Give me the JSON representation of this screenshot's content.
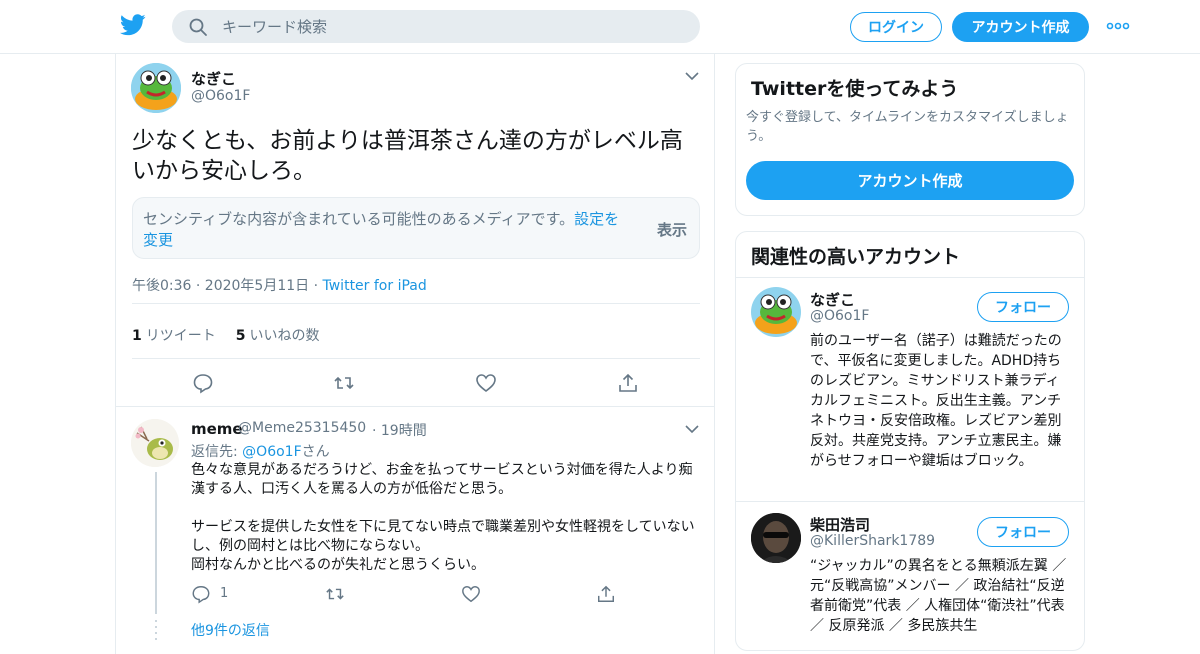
{
  "header": {
    "search_placeholder": "キーワード検索",
    "login_label": "ログイン",
    "signup_label": "アカウント作成"
  },
  "tweet": {
    "name": "なぎこ",
    "handle": "@O6o1F",
    "text": "少なくとも、お前よりは普洱茶さん達の方がレベル高いから安心しろ。",
    "sensitive_msg": "センシティブな内容が含まれている可能性のあるメディアです。",
    "sensitive_link": "設定を変更",
    "show_label": "表示",
    "time": "午後0:36 · 2020年5月11日",
    "via": "Twitter for iPad",
    "retweet_count": "1",
    "retweet_label": "リツイート",
    "like_count": "5",
    "like_label": "いいねの数"
  },
  "reply": {
    "name": "meme",
    "handle": "@Meme25315450",
    "time": "· 19時間",
    "reply_to_prefix": "返信先: ",
    "reply_to_handle": "@O6o1F",
    "reply_to_suffix": "さん",
    "para1": "色々な意見があるだろうけど、お金を払ってサービスという対価を得た人より痴漢する人、口汚く人を罵る人の方が低俗だと思う。",
    "para2a": "サービスを提供した女性を下に見てない時点で職業差別や女性軽視をしていないし、例の岡村とは比べ物にならない。",
    "para2b": "岡村なんかと比べるのが失礼だと思うくらい。",
    "reply_count": "1",
    "more_replies": "他9件の返信"
  },
  "signup_card": {
    "title": "Twitterを使ってみよう",
    "subtitle": "今すぐ登録して、タイムラインをカスタマイズしましょう。",
    "button": "アカウント作成"
  },
  "related": {
    "title": "関連性の高いアカウント",
    "follow_label": "フォロー",
    "accounts": [
      {
        "name": "なぎこ",
        "handle": "@O6o1F",
        "bio": "前のユーザー名（諾子）は難読だったので、平仮名に変更しました。ADHD持ちのレズビアン。ミサンドリスト兼ラディカルフェミニスト。反出生主義。アンチネトウヨ・反安倍政権。レズビアン差別反対。共産党支持。アンチ立憲民主。嫌がらせフォローや鍵垢はブロック。"
      },
      {
        "name": "柴田浩司",
        "handle": "@KillerShark1789",
        "bio": "“ジャッカル”の異名をとる無頼派左翼 ／ 元“反戦高協”メンバー ／ 政治結社“反逆者前衛党”代表 ／ 人権団体“衛渋社”代表 ／ 反原発派 ／ 多民族共生"
      }
    ]
  },
  "colors": {
    "accent": "#1da1f2",
    "link": "#1b95e0",
    "muted": "#657786",
    "border": "#e6ecf0"
  }
}
